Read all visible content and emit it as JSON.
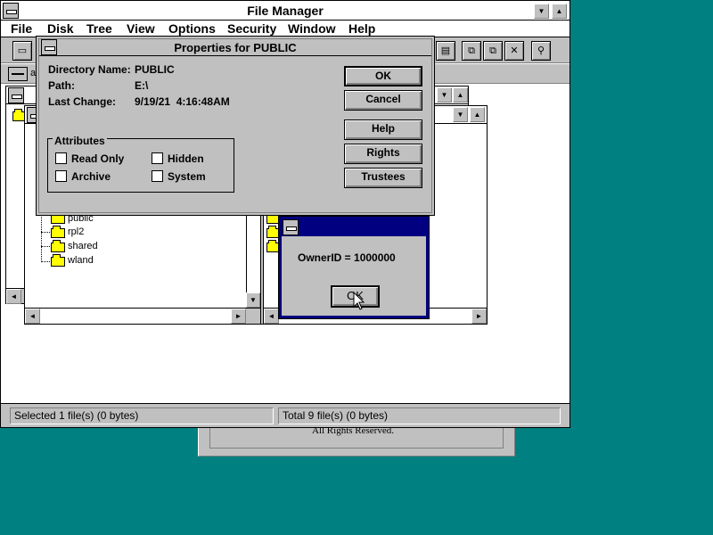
{
  "background_window": {
    "text": "All Rights Reserved."
  },
  "file_manager": {
    "title": "File Manager",
    "menu": [
      "File",
      "Disk",
      "Tree",
      "View",
      "Options",
      "Security",
      "Window",
      "Help"
    ],
    "drive_label": "a",
    "status": {
      "left": "Selected 1 file(s) (0 bytes)",
      "right": "Total 9 file(s) (0 bytes)"
    },
    "tree_items": [
      "public",
      "rpl2",
      "shared",
      "wland"
    ]
  },
  "properties_dialog": {
    "title": "Properties for PUBLIC",
    "directory_name_label": "Directory Name:",
    "directory_name_value": "PUBLIC",
    "path_label": "Path:",
    "path_value": "E:\\",
    "last_change_label": "Last Change:",
    "last_change_value": "9/19/21  4:16:48AM",
    "attributes_label": "Attributes",
    "attributes": {
      "read_only": "Read Only",
      "hidden": "Hidden",
      "archive": "Archive",
      "system": "System"
    },
    "buttons": {
      "ok": "OK",
      "cancel": "Cancel",
      "help": "Help",
      "rights": "Rights",
      "trustees": "Trustees"
    }
  },
  "owner_dialog": {
    "message": "OwnerID = 1000000",
    "ok": "OK"
  }
}
